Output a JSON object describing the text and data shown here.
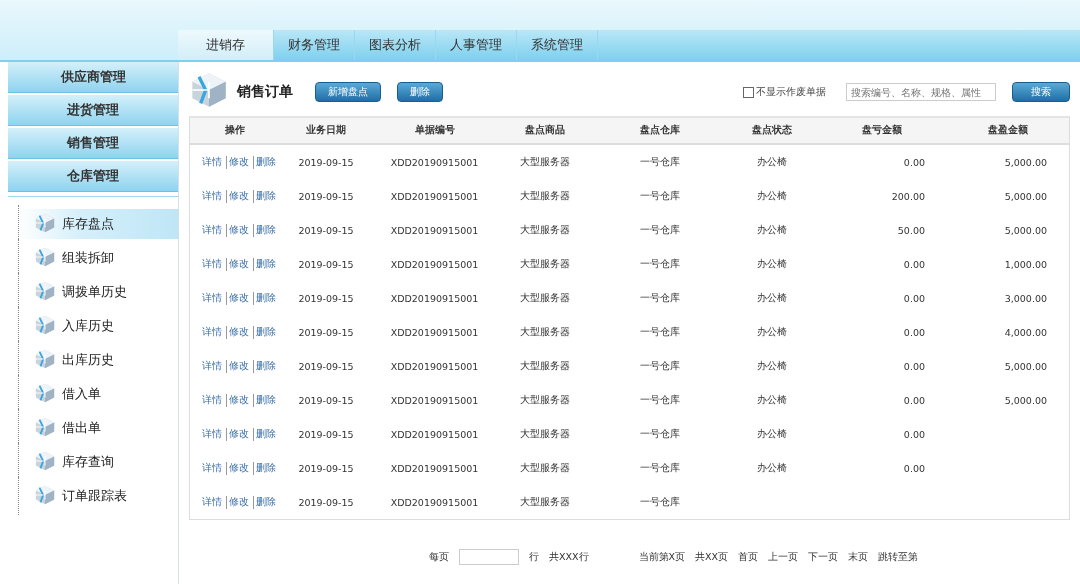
{
  "nav_tabs": [
    {
      "label": "进销存",
      "selected": true
    },
    {
      "label": "财务管理",
      "selected": false
    },
    {
      "label": "图表分析",
      "selected": false
    },
    {
      "label": "人事管理",
      "selected": false
    },
    {
      "label": "系统管理",
      "selected": false
    }
  ],
  "sidebar": {
    "groups": [
      "供应商管理",
      "进货管理",
      "销售管理",
      "仓库管理"
    ],
    "items": [
      {
        "label": "库存盘点",
        "selected": true
      },
      {
        "label": "组装拆卸",
        "selected": false
      },
      {
        "label": "调拨单历史",
        "selected": false
      },
      {
        "label": "入库历史",
        "selected": false
      },
      {
        "label": "出库历史",
        "selected": false
      },
      {
        "label": "借入单",
        "selected": false
      },
      {
        "label": "借出单",
        "selected": false
      },
      {
        "label": "库存查询",
        "selected": false
      },
      {
        "label": "订单跟踪表",
        "selected": false
      }
    ]
  },
  "panel": {
    "title": "销售订单",
    "buttons": [
      "新增盘点",
      "删除"
    ],
    "hide_void": {
      "label": "不显示作废单据",
      "checked": false
    },
    "search": {
      "placeholder": "搜索编号、名称、规格、属性",
      "button": "搜索"
    }
  },
  "table": {
    "columns": [
      "操作",
      "业务日期",
      "单据编号",
      "盘点商品",
      "盘点仓库",
      "盘点状态",
      "盘亏金额",
      "盘盈金额"
    ],
    "rows": [
      {
        "cells": [
          [
            "详情",
            "修改",
            "删除"
          ],
          "2019-09-15",
          "XDD20190915001",
          "大型服务器",
          "一号仓库",
          "办公椅",
          "0.00",
          "5,000.00"
        ]
      },
      {
        "cells": [
          [
            "详情",
            "修改",
            "删除"
          ],
          "2019-09-15",
          "XDD20190915001",
          "大型服务器",
          "一号仓库",
          "办公椅",
          "200.00",
          "5,000.00"
        ]
      },
      {
        "cells": [
          [
            "详情",
            "修改",
            "删除"
          ],
          "2019-09-15",
          "XDD20190915001",
          "大型服务器",
          "一号仓库",
          "办公椅",
          "50.00",
          "5,000.00"
        ]
      },
      {
        "cells": [
          [
            "详情",
            "修改",
            "删除"
          ],
          "2019-09-15",
          "XDD20190915001",
          "大型服务器",
          "一号仓库",
          "办公椅",
          "0.00",
          "1,000.00"
        ]
      },
      {
        "cells": [
          [
            "详情",
            "修改",
            "删除"
          ],
          "2019-09-15",
          "XDD20190915001",
          "大型服务器",
          "一号仓库",
          "办公椅",
          "0.00",
          "3,000.00"
        ]
      },
      {
        "cells": [
          [
            "详情",
            "修改",
            "删除"
          ],
          "2019-09-15",
          "XDD20190915001",
          "大型服务器",
          "一号仓库",
          "办公椅",
          "0.00",
          "4,000.00"
        ]
      },
      {
        "cells": [
          [
            "详情",
            "修改",
            "删除"
          ],
          "2019-09-15",
          "XDD20190915001",
          "大型服务器",
          "一号仓库",
          "办公椅",
          "0.00",
          "5,000.00"
        ]
      },
      {
        "cells": [
          [
            "详情",
            "修改",
            "删除"
          ],
          "2019-09-15",
          "XDD20190915001",
          "大型服务器",
          "一号仓库",
          "办公椅",
          "0.00",
          "5,000.00"
        ]
      },
      {
        "cells": [
          [
            "详情",
            "修改",
            "删除"
          ],
          "2019-09-15",
          "XDD20190915001",
          "大型服务器",
          "一号仓库",
          "办公椅",
          "0.00",
          ""
        ]
      },
      {
        "cells": [
          [
            "详情",
            "修改",
            "删除"
          ],
          "2019-09-15",
          "XDD20190915001",
          "大型服务器",
          "一号仓库",
          "办公椅",
          "0.00",
          ""
        ]
      },
      {
        "cells": [
          [
            "详情",
            "修改",
            "删除"
          ],
          "2019-09-15",
          "XDD20190915001",
          "大型服务器",
          "一号仓库",
          "",
          "",
          ""
        ]
      }
    ]
  },
  "pagination": {
    "per_page_label": "每页",
    "rows_unit": "行",
    "total_rows": "共XXX行",
    "current_page": "当前第X页",
    "total_pages": "共XX页",
    "links": [
      "首页",
      "上一页",
      "下一页",
      "末页"
    ],
    "jump_label": "跳转至第"
  }
}
